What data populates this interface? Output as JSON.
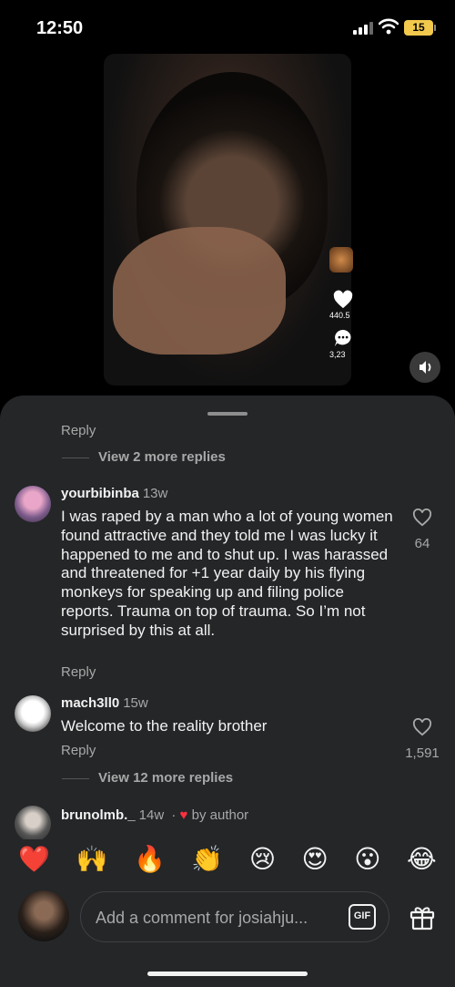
{
  "status_bar": {
    "time": "12:50",
    "battery": "15"
  },
  "video": {
    "side_likes": "440.5",
    "side_comments": "3,23"
  },
  "comments": {
    "top_reply": "Reply",
    "view_more_1": "View 2 more replies",
    "items": [
      {
        "username": "yourbibinba",
        "ago": "13w",
        "text": "I was raped by a man who a lot of young women found attractive and they told me I was lucky it happened to me and to shut up. I was harassed and threatened for +1 year daily by his flying monkeys for speaking up and filing police reports. Trauma on top of trauma. So I’m not surprised by this at all.",
        "reply": "Reply",
        "likes": "64"
      },
      {
        "username": "mach3ll0",
        "ago": "15w",
        "text": "Welcome to the reality brother",
        "reply": "Reply",
        "likes": "1,591",
        "view_more": "View 12 more replies"
      },
      {
        "username": "brunolmb._",
        "ago": "14w",
        "by_author": "by author"
      }
    ]
  },
  "emoji_bar": [
    "❤️",
    "🙌",
    "🔥",
    "👏",
    "😢",
    "😍",
    "😮",
    "😂"
  ],
  "comment_input": {
    "placeholder": "Add a comment for josiahju...",
    "gif_label": "GIF"
  },
  "colors": {
    "sheet_bg": "#242628",
    "secondary_text": "#a8a8a8",
    "heart_red": "#ff3040"
  },
  "icons": [
    "signal-icon",
    "wifi-icon",
    "battery-icon",
    "heart-icon",
    "comment-icon",
    "speaker-icon",
    "gift-icon"
  ]
}
